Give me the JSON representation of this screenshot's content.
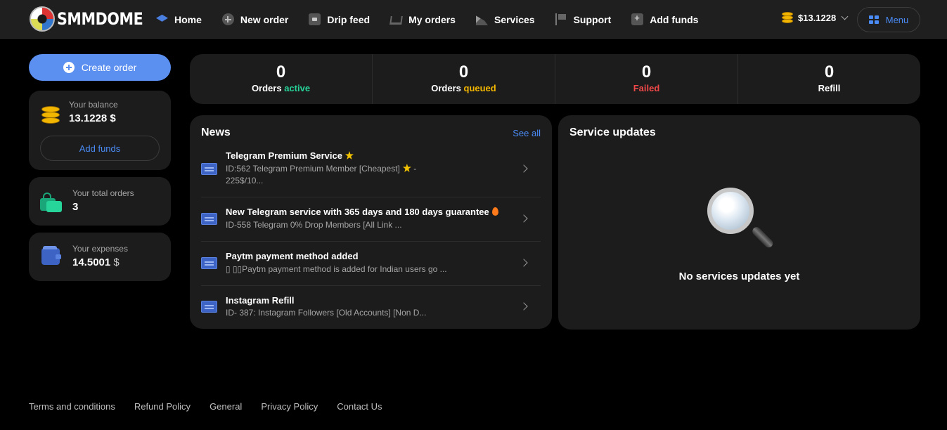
{
  "brand": {
    "name": "SMMDOME"
  },
  "nav": {
    "items": [
      {
        "label": "Home",
        "icon": "layers-icon"
      },
      {
        "label": "New order",
        "icon": "plus-circle-icon"
      },
      {
        "label": "Drip feed",
        "icon": "box-icon"
      },
      {
        "label": "My orders",
        "icon": "cart-icon"
      },
      {
        "label": "Services",
        "icon": "services-icon"
      },
      {
        "label": "Support",
        "icon": "flag-icon"
      },
      {
        "label": "Add funds",
        "icon": "add-funds-icon"
      }
    ],
    "balance": "$13.1228",
    "menu_label": "Menu"
  },
  "sidebar": {
    "create_order_label": "Create order",
    "balance_label": "Your balance",
    "balance_value": "13.1228 $",
    "add_funds_label": "Add funds",
    "orders_label": "Your total orders",
    "orders_value": "3",
    "expenses_label": "Your expenses",
    "expenses_value": "14.5001",
    "expenses_currency": "$"
  },
  "stats": [
    {
      "value": "0",
      "label_prefix": "Orders ",
      "label_accent": "active",
      "accent_color": "#27d49a"
    },
    {
      "value": "0",
      "label_prefix": "Orders ",
      "label_accent": "queued",
      "accent_color": "#f2b600"
    },
    {
      "value": "0",
      "label_prefix": "",
      "label_accent": "Failed",
      "accent_color": "#f04848"
    },
    {
      "value": "0",
      "label_prefix": "Refill",
      "label_accent": "",
      "accent_color": "#ffffff"
    }
  ],
  "news": {
    "title": "News",
    "see_all": "See all",
    "items": [
      {
        "title": "Telegram Premium Service",
        "desc": "ID:562 Telegram Premium Member [Cheapest]",
        "desc_tail": " - 225$/10..."
      },
      {
        "title": "New Telegram service with 365 days and 180 days guarantee",
        "desc": "ID-558 Telegram 0% Drop Members [All Link ..."
      },
      {
        "title": "Paytm payment method added",
        "desc": "▯ ▯▯Paytm payment method is added for Indian users go ..."
      },
      {
        "title": "Instagram Refill",
        "desc": "ID- 387: Instagram Followers [Old Accounts] [Non D..."
      }
    ]
  },
  "service_updates": {
    "title": "Service updates",
    "empty_text": "No services updates yet"
  },
  "footer": {
    "links": [
      "Terms and conditions",
      "Refund Policy",
      "General",
      "Privacy Policy",
      "Contact Us"
    ]
  },
  "colors": {
    "accent": "#5b8ff0",
    "link": "#4a8bf5",
    "card": "#1c1c1c",
    "background": "#000000"
  }
}
